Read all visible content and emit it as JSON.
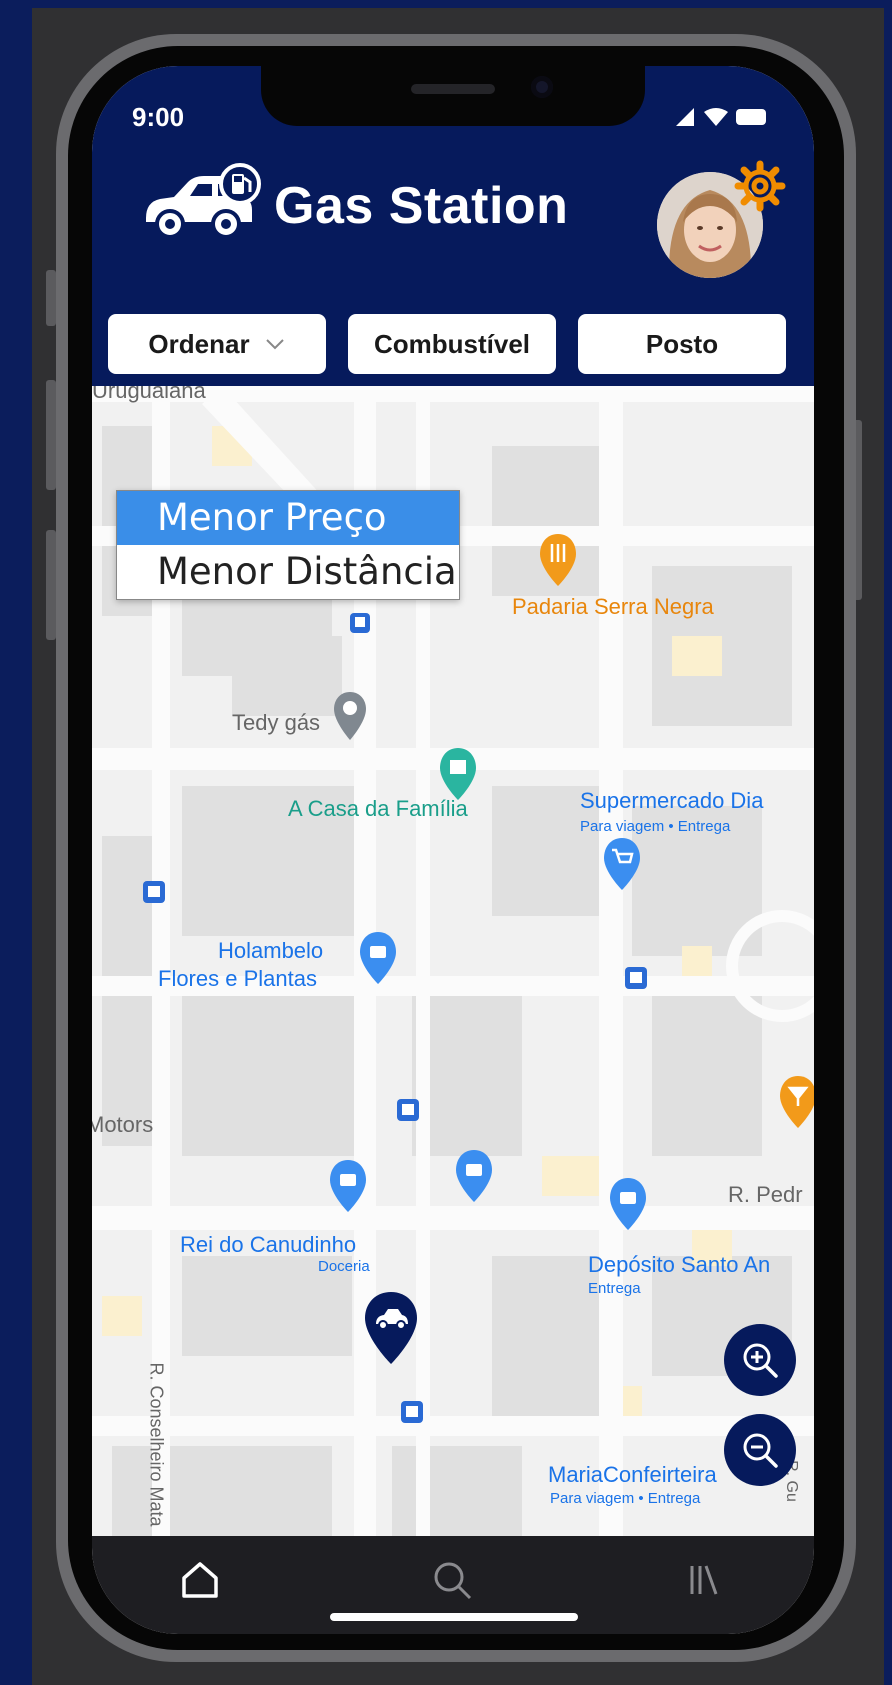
{
  "status_bar": {
    "time": "9:00",
    "icons": [
      "signal-icon",
      "wifi-icon",
      "battery-icon"
    ]
  },
  "header": {
    "title": "Gas Station",
    "logo_icon": "car-fuel-icon",
    "settings_icon": "gear-icon",
    "avatar": "user-avatar",
    "background": "#061a5c",
    "accent": "#f08c00"
  },
  "filters": {
    "sort_label": "Ordenar",
    "fuel_label": "Combustível",
    "station_label": "Posto"
  },
  "sort_menu": {
    "options": [
      "Menor Preço",
      "Menor Distância"
    ],
    "selected": "Menor Preço",
    "highlight": "#3a8ee8"
  },
  "map": {
    "places": {
      "uruguaiana": "Uruguaiana",
      "padaria": "Padaria Serra Negra",
      "tedy": "Tedy gás",
      "casa": "A Casa da Família",
      "supermercado": "Supermercado Dia",
      "supermercado_sub": "Para viagem • Entrega",
      "holambelo1": "Holambelo",
      "holambelo2": "Flores e Plantas",
      "motors": "Motors",
      "rpedr": "R. Pedr",
      "rei": "Rei do Canudinho",
      "rei_sub": "Doceria",
      "deposito": "Depósito Santo An",
      "deposito_sub": "Entrega",
      "conselheiro": "R. Conselheiro Mata",
      "maria": "MariaConfeirteira",
      "maria_sub": "Para viagem • Entrega",
      "rgu": "R. Gu"
    },
    "zoom_in_icon": "zoom-in-icon",
    "zoom_out_icon": "zoom-out-icon",
    "marker_icon": "gas-station-marker-icon"
  },
  "bottom_nav": {
    "items": [
      "home-icon",
      "search-icon",
      "library-icon"
    ]
  }
}
